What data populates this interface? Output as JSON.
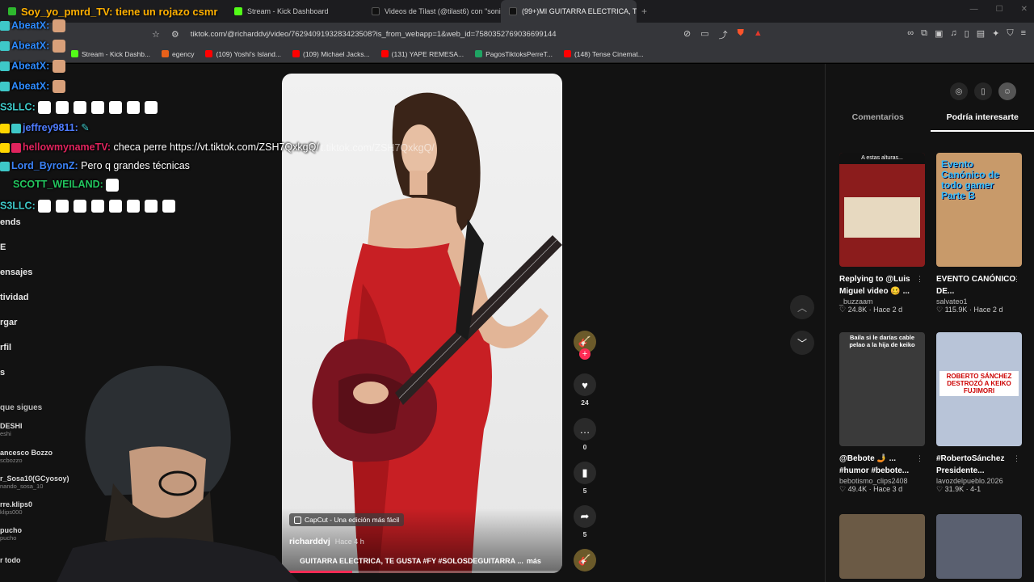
{
  "browser": {
    "tabs": [
      {
        "title": "Soy_yo_pmrd_TV: tiene un rojazo csmr",
        "color": "#2eb82e"
      },
      {
        "title": "Stream - Kick Dashboard",
        "color": "#53fc18"
      },
      {
        "title": "Videos de Tilast (@tilast6) con \"sonid",
        "color": "#fe2c55"
      },
      {
        "title": "(99+)MI GUITARRA ELECTRICA, T",
        "color": "#fe2c55",
        "active": true
      }
    ],
    "url": "tiktok.com/@richarddvj/video/7629409193283423508?is_from_webapp=1&web_id=7580352769036699144",
    "bookmarks": [
      {
        "label": "Stream - Kick Dashb...",
        "color": "#53fc18"
      },
      {
        "label": "egency",
        "color": "#e8611a"
      },
      {
        "label": "(109) Yoshi's Island...",
        "color": "#ff0000"
      },
      {
        "label": "(109) Michael Jacks...",
        "color": "#ff0000"
      },
      {
        "label": "(131) YAPE REMESA...",
        "color": "#ff0000"
      },
      {
        "label": "PagosTiktoksPerreT...",
        "color": "#1fa463"
      },
      {
        "label": "(148) Tense Cinemat...",
        "color": "#ff0000"
      }
    ]
  },
  "chat": [
    {
      "user": "AbeatX:",
      "color": "#2e8bff",
      "text": ""
    },
    {
      "user": "AbeatX:",
      "color": "#2e8bff",
      "text": ""
    },
    {
      "user": "AbeatX:",
      "color": "#2e8bff",
      "text": ""
    },
    {
      "user": "AbeatX:",
      "color": "#2e8bff",
      "text": ""
    },
    {
      "user": "S3LLC:",
      "color": "#3ec8c8",
      "text": ""
    },
    {
      "user": "jeffrey9811:",
      "color": "#4f7cff",
      "text": ""
    },
    {
      "user": "hellowmynameTV:",
      "color": "#e0245e",
      "text": "checa perre https://vt.tiktok.com/ZSH7QxkgQ/"
    },
    {
      "user": "Lord_ByronZ:",
      "color": "#3b82f6",
      "text": "Pero q grandes técnicas"
    },
    {
      "user": "SCOTT_WEILAND:",
      "color": "#22c55e",
      "text": ""
    },
    {
      "user": "S3LLC:",
      "color": "#3ec8c8",
      "text": ""
    }
  ],
  "left_nav": {
    "items": [
      "ends",
      "E",
      "ensajes",
      "tividad",
      "rgar",
      "rfil",
      "s"
    ],
    "following_title": "que sigues",
    "accounts": [
      {
        "name": "DESHI",
        "sub": "eshi"
      },
      {
        "name": "ancesco Bozzo",
        "sub": "scbozzo"
      },
      {
        "name": "r_Sosa10(GCyosoy)",
        "sub": "nando_sosa_10"
      },
      {
        "name": "rre.klips0",
        "sub": "klips000"
      },
      {
        "name": "pucho",
        "sub": "pucho"
      },
      {
        "name": "r todo",
        "sub": ""
      }
    ]
  },
  "video": {
    "capcut": "CapCut - Una edición más fácil",
    "author": "richarddvj",
    "time": "Hace 4 h",
    "description": "GUITARRA ELECTRICA, TE GUSTA #FY #SOLOSDEGUITARRA ...",
    "more": "más",
    "progress": 0.25,
    "overlay_link": "https://vt.tiktok.com/ZSH7QxkgQ/"
  },
  "actions": {
    "likes": "24",
    "comments": "0",
    "saves": "5",
    "shares": "5"
  },
  "right_panel": {
    "tabs": [
      "Comentarios",
      "Podría interesarte"
    ],
    "recommendations": [
      {
        "title": "Replying to @Luis Miguel video 🥴 ...",
        "author": "_buzzaam",
        "stats": "♡ 24.8K · Hace 2 d",
        "thumb_text": "A estas alturas...",
        "thumb_color": "#8b1c1c"
      },
      {
        "title": "EVENTO CANÓNICO DE...",
        "author": "salvateo1",
        "stats": "♡ 115.9K · Hace 2 d",
        "thumb_text": "Evento Canónico de todo gamer Parte B",
        "thumb_color": "#c89a6a"
      },
      {
        "title": "@Bebote 🤳 ... #humor #bebote...",
        "author": "bebotismo_clips2408",
        "stats": "♡ 49.4K · Hace 3 d",
        "thumb_text": "Baila si le darías cable pelao a la hija de keiko",
        "thumb_color": "#3a3a3a"
      },
      {
        "title": "#RobertoSánchez Presidente...",
        "author": "lavozdelpueblo.2026",
        "stats": "♡ 31.9K · 4-1",
        "thumb_text": "ROBERTO SÁNCHEZ DESTROZÓ A KEIKO FUJIMORI",
        "thumb_color": "#b8c4d8"
      },
      {
        "title": "",
        "author": "",
        "stats": "",
        "thumb_text": "",
        "thumb_color": "#6b5a45"
      },
      {
        "title": "",
        "author": "",
        "stats": "",
        "thumb_text": "",
        "thumb_color": "#5a6070"
      }
    ]
  },
  "colors": {
    "tiktok_red": "#fe2c55",
    "page_bg": "#121212"
  }
}
